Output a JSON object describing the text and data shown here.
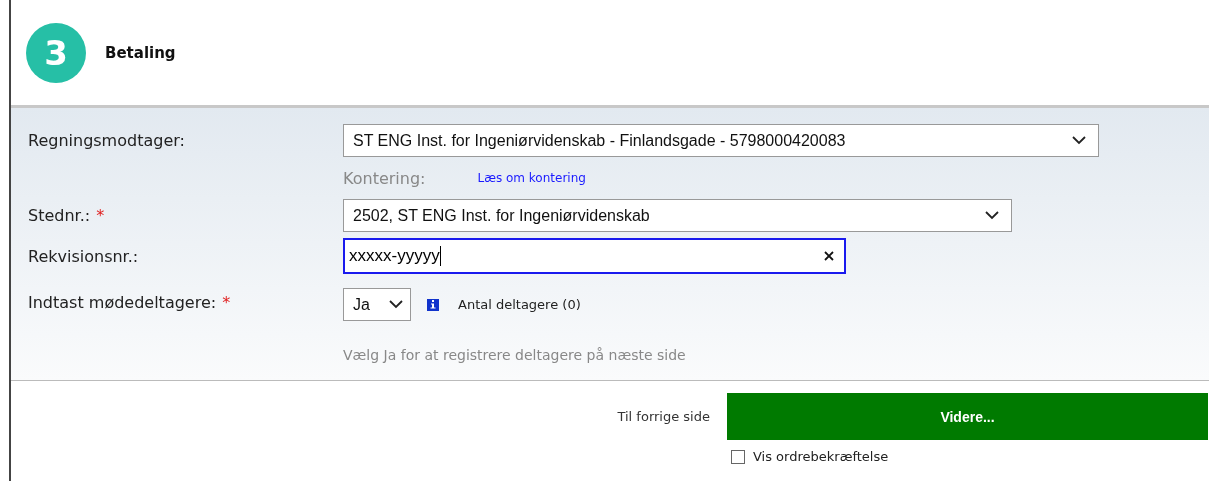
{
  "step": {
    "number": "3",
    "title": "Betaling"
  },
  "fields": [
    {
      "kind": "select",
      "label": "Regningsmodtager:",
      "value": "ST ENG Inst. for Ingeniørvidenskab - Finlandsgade - 5798000420083"
    },
    {
      "kind": "note",
      "label": "Kontering:",
      "link": "Læs om kontering"
    },
    {
      "kind": "select",
      "label": "Stednr.:",
      "required_mark": "*",
      "value": "2502, ST ENG Inst. for Ingeniørvidenskab"
    },
    {
      "kind": "input",
      "label": "Rekvisionsnr.:",
      "value": "xxxxx-yyyyy",
      "focused": true
    },
    {
      "kind": "yesno",
      "label": "Indtast mødedeltagere:",
      "required_mark": "*",
      "value": "Ja",
      "info": "Antal deltagere (0)",
      "hint": "Vælg Ja for at registrere deltagere på næste side"
    }
  ],
  "footer": {
    "back_link": "Til forrige side",
    "next_button": "Videre...",
    "confirm": {
      "label": "Vis ordrebekræftelse",
      "checked": false
    }
  }
}
